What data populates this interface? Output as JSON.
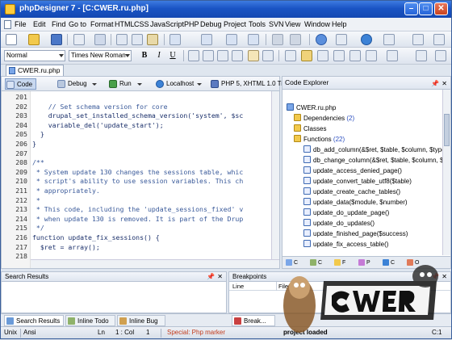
{
  "window": {
    "title": "phpDesigner 7 - [C:CWER.ru.php]"
  },
  "menu": [
    "File",
    "Edit",
    "Find",
    "Go to",
    "Format",
    "HTML",
    "CSS",
    "JavaScript",
    "PHP",
    "Debug",
    "Project",
    "Tools",
    "SVN",
    "View",
    "Window",
    "Help"
  ],
  "format_toolbar": {
    "style": "Normal",
    "font": "Times New Roman",
    "bold": "B",
    "italic": "I",
    "underline": "U"
  },
  "doc_tab": {
    "label": "CWER.ru.php"
  },
  "editor_toolbar": {
    "code": "Code",
    "debug": "Debug",
    "run": "Run",
    "localhost": "Localhost",
    "php_mode": "PHP 5, XHTML 1.0 Trans"
  },
  "code_lines": [
    {
      "num": "201",
      "text": "",
      "kind": "code"
    },
    {
      "num": "202",
      "text": "    // Set schema version for core",
      "kind": "comment"
    },
    {
      "num": "203",
      "text": "    drupal_set_installed_schema_version('system', $sc",
      "kind": "code"
    },
    {
      "num": "204",
      "text": "    variable_del('update_start');",
      "kind": "code"
    },
    {
      "num": "205",
      "text": "  }",
      "kind": "code"
    },
    {
      "num": "206",
      "text": "}",
      "kind": "code"
    },
    {
      "num": "207",
      "text": "",
      "kind": "code"
    },
    {
      "num": "208",
      "text": "/**",
      "kind": "comment"
    },
    {
      "num": "209",
      "text": " * System update 130 changes the sessions table, whic",
      "kind": "comment"
    },
    {
      "num": "210",
      "text": " * script's ability to use session variables. This ch",
      "kind": "comment"
    },
    {
      "num": "211",
      "text": " * appropriately.",
      "kind": "comment"
    },
    {
      "num": "212",
      "text": " *",
      "kind": "comment"
    },
    {
      "num": "213",
      "text": " * This code, including the 'update_sessions_fixed' v",
      "kind": "comment"
    },
    {
      "num": "214",
      "text": " * when update 130 is removed. It is part of the Drup",
      "kind": "comment"
    },
    {
      "num": "215",
      "text": " */",
      "kind": "comment"
    },
    {
      "num": "216",
      "text": "function update_fix_sessions() {",
      "kind": "code"
    },
    {
      "num": "217",
      "text": "  $ret = array();",
      "kind": "code"
    },
    {
      "num": "218",
      "text": "",
      "kind": "code"
    }
  ],
  "explorer": {
    "title": "Code Explorer",
    "root": "CWER.ru.php",
    "dependencies": {
      "label": "Dependencies",
      "count": "(2)"
    },
    "classes": {
      "label": "Classes"
    },
    "functions": {
      "label": "Functions",
      "count": "(22)"
    },
    "items": [
      "db_add_column(&$ret, $table, $column, $type",
      "db_change_column(&$ret, $table, $column, $",
      "update_access_denied_page()",
      "update_convert_table_utf8($table)",
      "update_create_cache_tables()",
      "update_data($module, $number)",
      "update_do_update_page()",
      "update_do_updates()",
      "update_finished_page($success)",
      "update_fix_access_table()"
    ],
    "tabs": [
      "C",
      "C",
      "F",
      "P",
      "C",
      "O"
    ]
  },
  "search_panel": {
    "title": "Search Results"
  },
  "breakpoints_panel": {
    "title": "Breakpoints",
    "col_line": "Line",
    "col_file": "File"
  },
  "bottom_tabs": [
    "Search Results",
    "Inline Todo",
    "Inline Bug",
    "Break..."
  ],
  "status": {
    "eol": "Unix",
    "encoding": "Ansi",
    "ln_label": "Ln",
    "position": "1 : Col",
    "col": "1",
    "marker": "Special: Php marker",
    "project": "project loaded",
    "right": "C:1"
  },
  "colors": {
    "title_bar": "#1a54c4",
    "comment": "#3a5a9a",
    "status_marker": "#c23b1b"
  }
}
